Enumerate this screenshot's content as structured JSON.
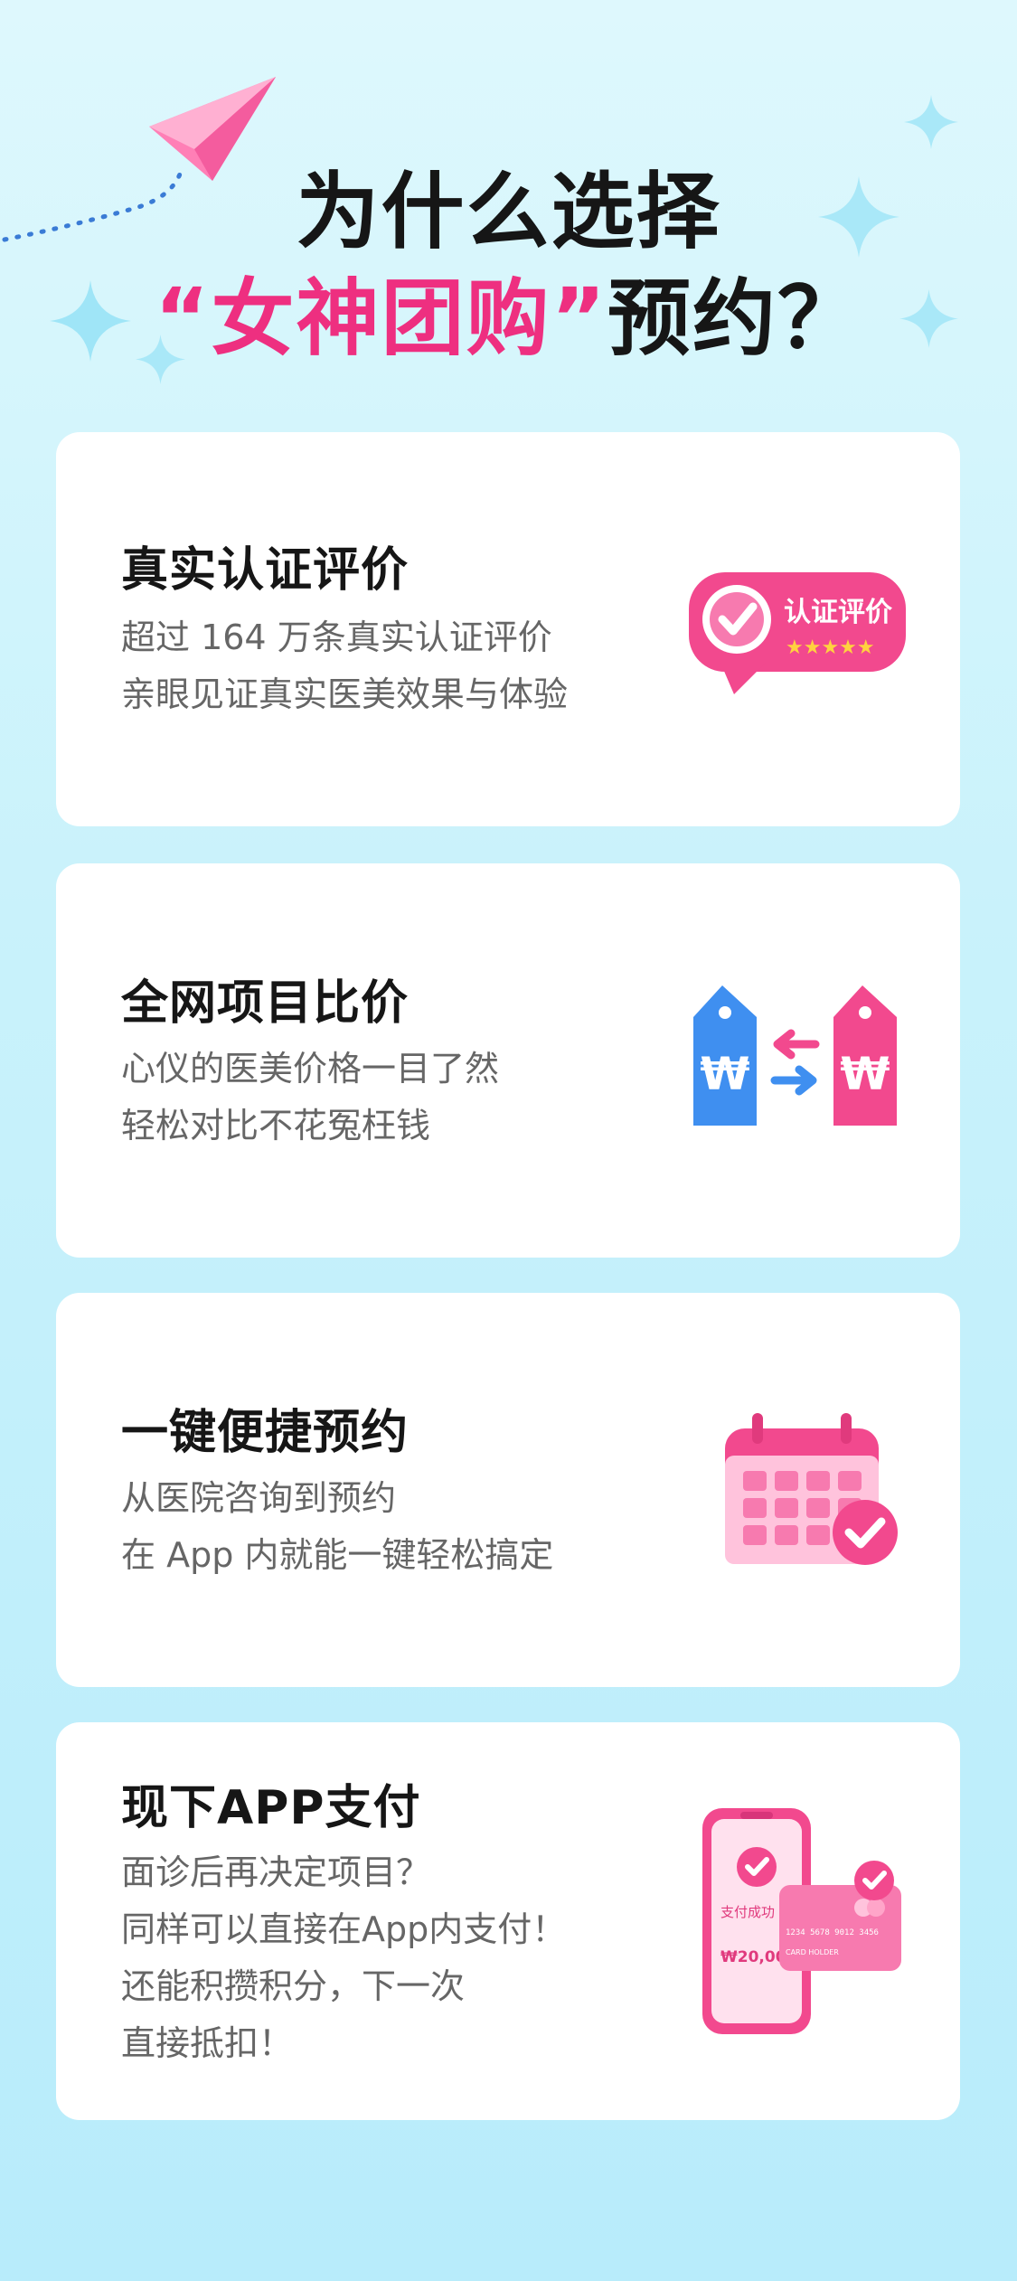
{
  "hero": {
    "title_line1": "为什么选择",
    "brand_quoted": "“女神团购”",
    "title_line2_suffix": "预约？"
  },
  "features": [
    {
      "title": "真实认证评价",
      "desc": [
        "超过 164 万条真实认证评价",
        "亲眼见证真实医美效果与体验"
      ],
      "icon": "verified-review-badge-icon",
      "badge_text": "认证评价"
    },
    {
      "title": "全网项目比价",
      "desc": [
        "心仪的医美价格一目了然",
        "轻松对比不花冤枉钱"
      ],
      "icon": "price-compare-tags-icon",
      "tag_symbol": "₩"
    },
    {
      "title": "一键便捷预约",
      "desc": [
        "从医院咨询到预约",
        "在 App 内就能一键轻松搞定"
      ],
      "icon": "calendar-check-icon"
    },
    {
      "title": "现下APP支付",
      "desc": [
        "面诊后再决定项目？",
        "同样可以直接在App内支付！",
        "还能积攒积分，下一次",
        "直接抵扣！"
      ],
      "icon": "mobile-payment-icon",
      "phone_text": "支付成功",
      "phone_amount": "₩20,000",
      "card_number": "1234 5678 9012 3456",
      "card_holder": "CARD HOLDER"
    }
  ],
  "colors": {
    "accent_pink": "#ee2f80",
    "title": "#161616",
    "desc": "#666666"
  }
}
